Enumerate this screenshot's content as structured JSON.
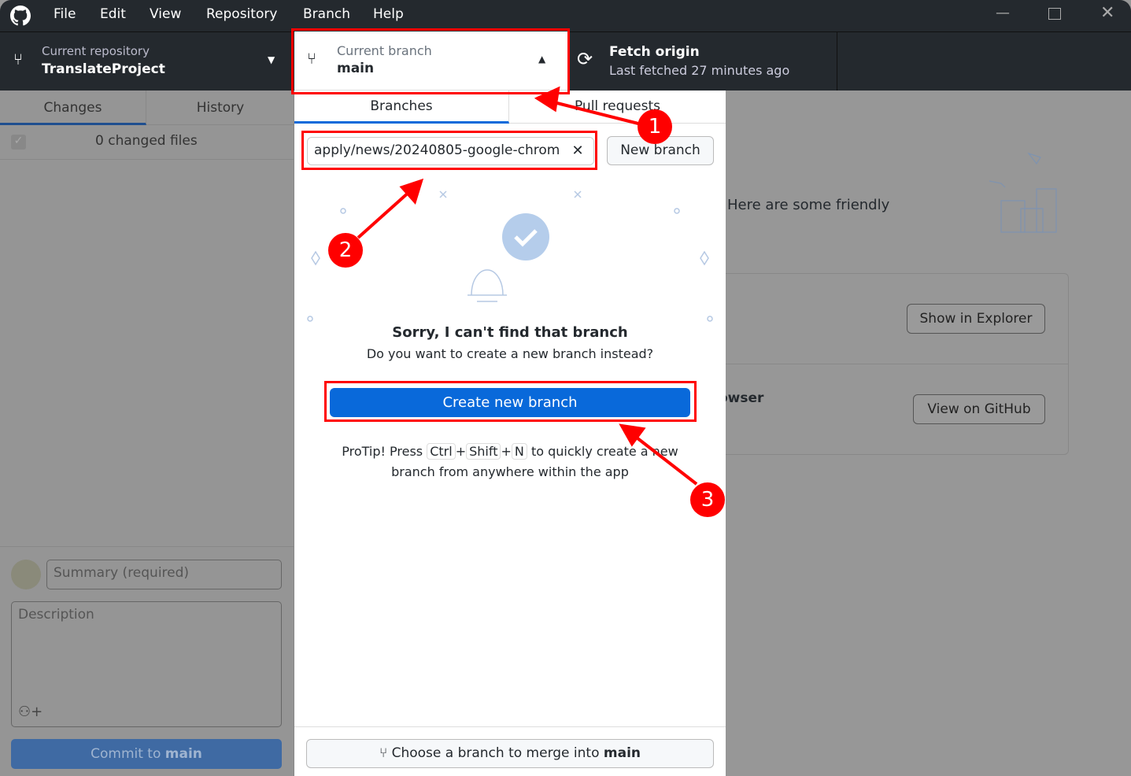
{
  "menu": [
    "File",
    "Edit",
    "View",
    "Repository",
    "Branch",
    "Help"
  ],
  "toolbar": {
    "repo_label": "Current repository",
    "repo_name": "TranslateProject",
    "branch_label": "Current branch",
    "branch_name": "main",
    "fetch_title": "Fetch origin",
    "fetch_sub": "Last fetched 27 minutes ago"
  },
  "sidebar": {
    "tabs": [
      "Changes",
      "History"
    ],
    "changed_files": "0 changed files",
    "summary_placeholder": "Summary (required)",
    "description_placeholder": "Description",
    "commit_prefix": "Commit to ",
    "commit_branch": "main"
  },
  "main": {
    "friendly_text": "Here are some friendly",
    "browser_text": "owser",
    "show_in_explorer": "Show in Explorer",
    "view_on_github": "View on GitHub"
  },
  "dropdown": {
    "tabs": [
      "Branches",
      "Pull requests"
    ],
    "filter_value": "apply/news/20240805-google-chrom",
    "new_branch": "New branch",
    "empty_title": "Sorry, I can't find that branch",
    "empty_sub": "Do you want to create a new branch instead?",
    "create_button": "Create new branch",
    "protip_pre": "ProTip! Press",
    "key_ctrl": "Ctrl",
    "key_shift": "Shift",
    "key_n": "N",
    "plus": "+",
    "protip_post": "to quickly create a new",
    "protip_line2": "branch from anywhere within the app",
    "merge_prefix": "Choose a branch to merge into ",
    "merge_branch": "main"
  },
  "annotations": [
    "1",
    "2",
    "3"
  ],
  "colors": {
    "accent": "#0969da",
    "annotation": "#ff0000",
    "titlebar": "#24292e"
  }
}
